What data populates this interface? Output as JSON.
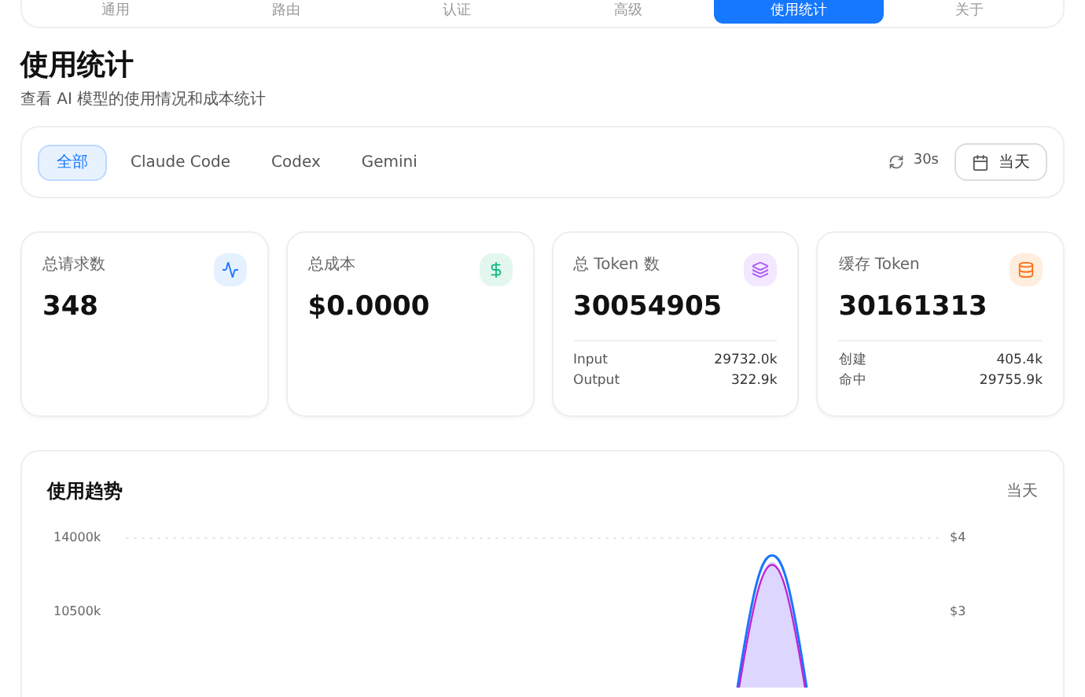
{
  "nav_tabs": [
    {
      "label": "通用",
      "selected": false
    },
    {
      "label": "路由",
      "selected": false
    },
    {
      "label": "认证",
      "selected": false
    },
    {
      "label": "高级",
      "selected": false
    },
    {
      "label": "使用统计",
      "selected": true
    },
    {
      "label": "关于",
      "selected": false
    }
  ],
  "page": {
    "title": "使用统计",
    "subtitle": "查看 AI 模型的使用情况和成本统计"
  },
  "filters": {
    "tabs": [
      {
        "label": "全部",
        "selected": true
      },
      {
        "label": "Claude Code",
        "selected": false
      },
      {
        "label": "Codex",
        "selected": false
      },
      {
        "label": "Gemini",
        "selected": false
      }
    ],
    "refresh_interval": "30s",
    "date_range": "当天"
  },
  "stats": [
    {
      "kind": "requests",
      "label": "总请求数",
      "value": "348"
    },
    {
      "kind": "cost",
      "label": "总成本",
      "value": "$0.0000"
    },
    {
      "kind": "tokens",
      "label": "总 Token 数",
      "value": "30054905",
      "details": [
        {
          "label": "Input",
          "value": "29732.0k"
        },
        {
          "label": "Output",
          "value": "322.9k"
        }
      ]
    },
    {
      "kind": "cache",
      "label": "缓存 Token",
      "value": "30161313",
      "details": [
        {
          "label": "创建",
          "value": "405.4k"
        },
        {
          "label": "命中",
          "value": "29755.9k"
        }
      ]
    }
  ],
  "trend": {
    "title": "使用趋势",
    "range": "当天",
    "left_ticks": [
      "14000k",
      "10500k"
    ],
    "right_ticks": [
      "$4",
      "$3"
    ]
  }
}
